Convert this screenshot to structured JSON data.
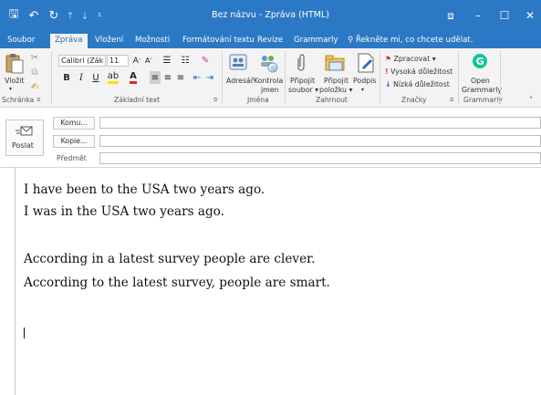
{
  "window": {
    "title": "Bez názvu - Zpráva (HTML)",
    "qat": {
      "save": "🖫",
      "undo": "↶",
      "redo": "↻",
      "up": "↑",
      "down": "↓",
      "more": "⩡"
    },
    "controls": {
      "restore": "⧈",
      "minimize": "–",
      "maximize": "☐",
      "close": "✕"
    }
  },
  "tabs": [
    "Soubor",
    "Zpráva",
    "Vložení",
    "Možnosti",
    "Formátování textu",
    "Revize",
    "Grammarly"
  ],
  "tell_me": "Řekněte mi, co chcete udělat.",
  "ribbon": {
    "clipboard": {
      "paste": "Vložit",
      "label": "Schránka"
    },
    "basic_text": {
      "font": "Calibri (Zák",
      "size": "11",
      "label": "Základní text"
    },
    "names": {
      "address_book": "Adresář",
      "check_names_1": "Kontrola",
      "check_names_2": "jmen",
      "label": "Jména"
    },
    "include": {
      "attach_file_1": "Připojit",
      "attach_file_2": "soubor",
      "attach_item_1": "Připojit",
      "attach_item_2": "položku",
      "signature": "Podpis",
      "label": "Zahrnout"
    },
    "tags": {
      "follow_up": "Zpracovat",
      "high_importance": "Vysoká důležitost",
      "low_importance": "Nízká důležitost",
      "label": "Značky"
    },
    "grammarly": {
      "open_1": "Open",
      "open_2": "Grammarly",
      "label": "Grammarly"
    }
  },
  "header": {
    "send": "Poslat",
    "to": "Komu...",
    "cc": "Kopie...",
    "subject": "Předmět"
  },
  "body": {
    "lines": [
      "I have been to the USA two years ago.",
      "I was in the USA two years ago.",
      "According in a latest survey people are clever.",
      "According to the latest survey, people are smart."
    ]
  },
  "colors": {
    "title_bar": "#2b78c5",
    "ribbon_bg": "#f3f3f3",
    "grammarly_green": "#15c39a",
    "flag_red": "#c0392b",
    "low_importance_blue": "#1f5fbf"
  }
}
